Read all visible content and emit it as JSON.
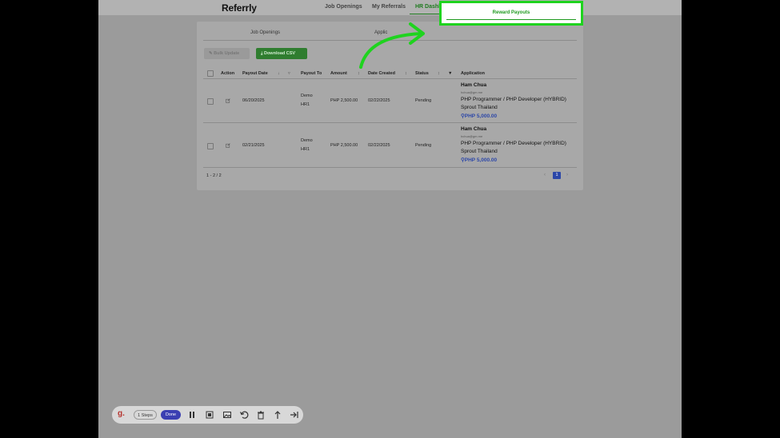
{
  "app": {
    "logo": "Referrly",
    "nav": [
      {
        "label": "Job Openings"
      },
      {
        "label": "My Referrals"
      },
      {
        "label": "HR Dashboard"
      }
    ]
  },
  "tabs": [
    {
      "label": "Job Openings"
    },
    {
      "label": "Applic"
    },
    {
      "label": "Reward Payouts"
    }
  ],
  "actions": {
    "bulk_update": "Bulk Update",
    "download_csv": "Download CSV"
  },
  "table": {
    "headers": {
      "action": "Action",
      "payout_date": "Payout Date",
      "payout_to": "Payout To",
      "amount": "Amount",
      "date_created": "Date Created",
      "status": "Status",
      "application": "Application"
    },
    "rows": [
      {
        "payout_date": "06/20/2025",
        "payout_to_1": "Demo",
        "payout_to_2": "HR1",
        "amount": "PHP 2,500.00",
        "date_created": "02/22/2025",
        "status": "Pending",
        "applicant": "Ham Chua",
        "email": "hchua@gm.me",
        "position": "PHP Programmer / PHP Developer (HYBRID)",
        "company": "Sprout Thailand",
        "reward": "PHP 5,000.00"
      },
      {
        "payout_date": "02/21/2025",
        "payout_to_1": "Demo",
        "payout_to_2": "HR1",
        "amount": "PHP 2,500.00",
        "date_created": "02/22/2025",
        "status": "Pending",
        "applicant": "Ham Chua",
        "email": "hchua@gm.me",
        "position": "PHP Programmer / PHP Developer (HYBRID)",
        "company": "Sprout Thailand",
        "reward": "PHP 5,000.00"
      }
    ]
  },
  "pagination": {
    "info": "1 - 2 / 2",
    "current": "1",
    "prev": "‹",
    "next": "›"
  },
  "recorder": {
    "steps": "1 Steps",
    "done": "Done",
    "logo": "g."
  },
  "colors": {
    "highlight": "#1fd31f",
    "arrow": "#1fd31f",
    "primary_green": "#2f7d2f",
    "reward_blue": "#2c47a8"
  }
}
